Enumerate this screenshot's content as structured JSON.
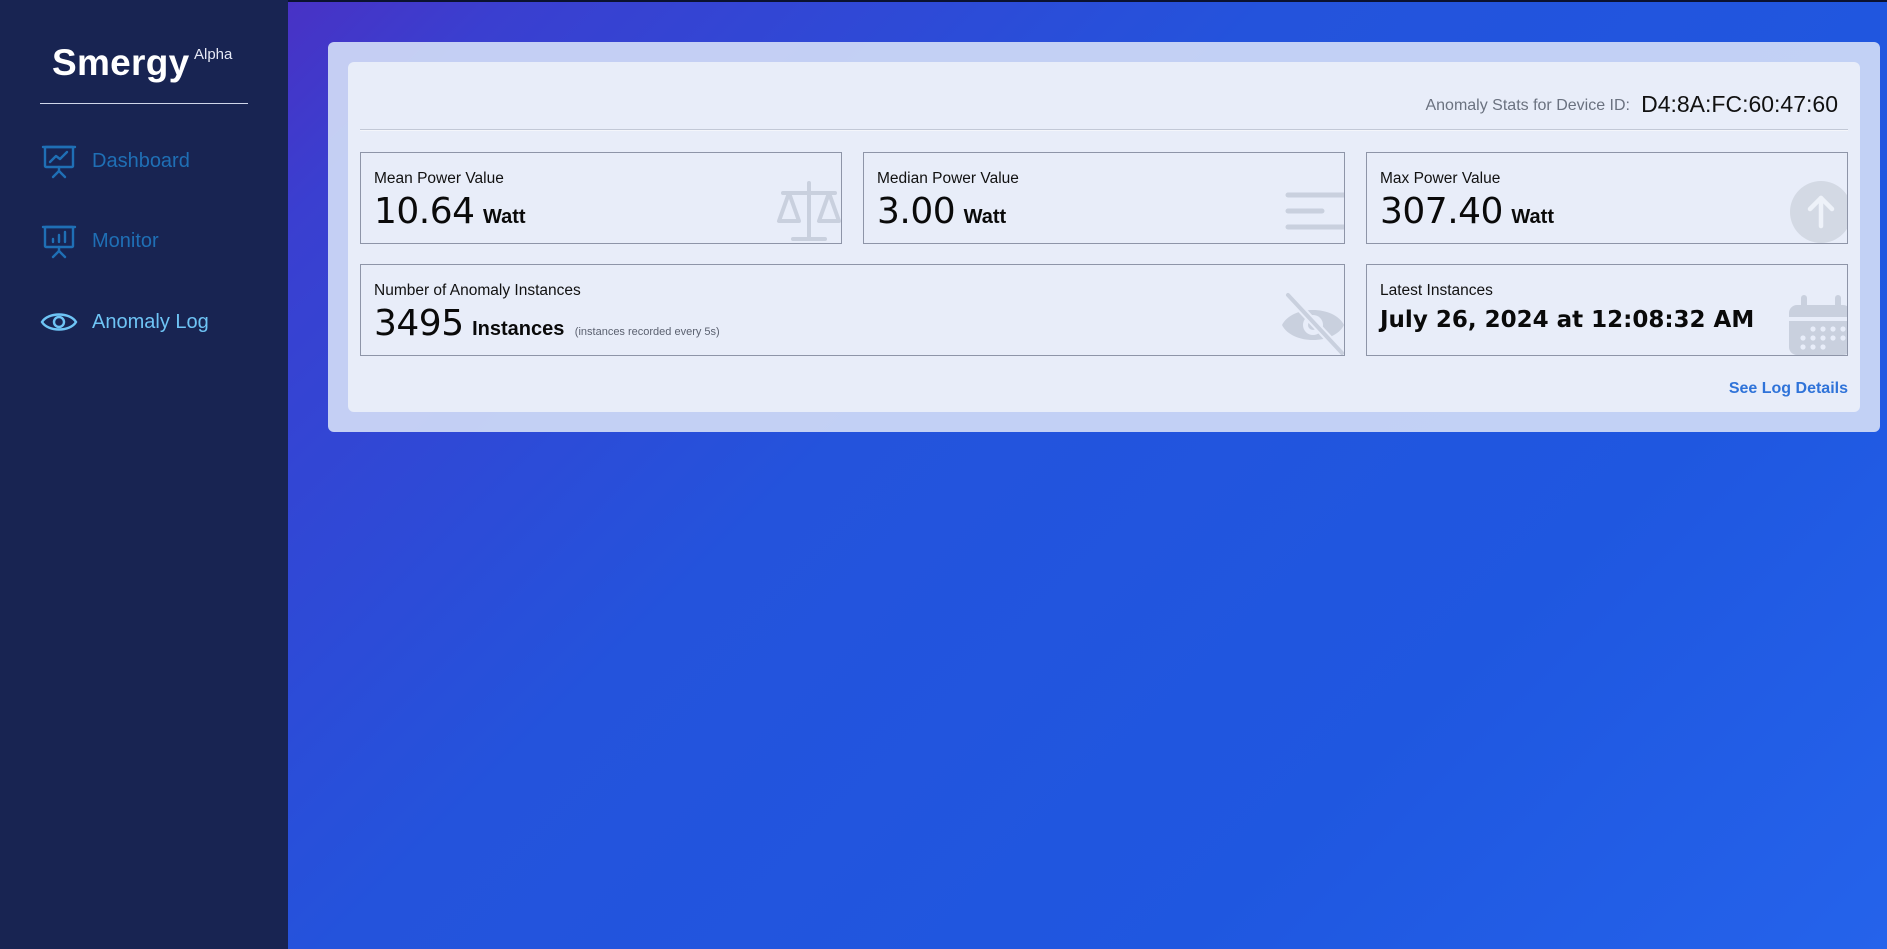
{
  "brand": {
    "name": "Smergy",
    "tag": "Alpha"
  },
  "nav": [
    {
      "label": "Dashboard",
      "icon": "chart-presentation-icon",
      "active": false
    },
    {
      "label": "Monitor",
      "icon": "bar-presentation-icon",
      "active": false
    },
    {
      "label": "Anomaly Log",
      "icon": "eye-icon",
      "active": true
    }
  ],
  "header": {
    "device_label": "Anomaly Stats for Device ID:",
    "device_id": "D4:8A:FC:60:47:60"
  },
  "cards": {
    "mean": {
      "title": "Mean Power Value",
      "value": "10.64",
      "unit": "Watt",
      "icon": "scale-icon"
    },
    "median": {
      "title": "Median Power Value",
      "value": "3.00",
      "unit": "Watt",
      "icon": "align-lines-icon"
    },
    "max": {
      "title": "Max Power Value",
      "value": "307.40",
      "unit": "Watt",
      "icon": "arrow-up-circle-icon"
    },
    "count": {
      "title": "Number of Anomaly Instances",
      "value": "3495",
      "unit": "Instances",
      "note": "(instances recorded every 5s)",
      "icon": "eye-slash-icon"
    },
    "latest": {
      "title": "Latest Instances",
      "value": "July 26, 2024 at 12:08:32 AM",
      "icon": "calendar-icon"
    }
  },
  "link": {
    "see_log": "See Log Details"
  },
  "colors": {
    "sidebar": "#182452",
    "accent": "#2f73d9",
    "nav_inactive": "#1f6fb5",
    "nav_active": "#6ec4f5"
  }
}
